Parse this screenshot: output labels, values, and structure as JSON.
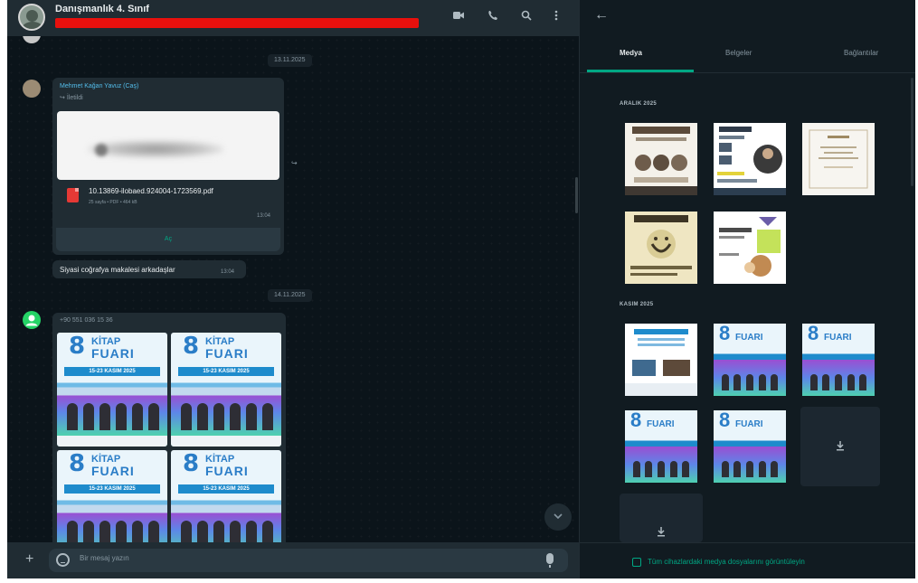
{
  "chat": {
    "title": "Danışmanlık 4. Sınıf",
    "header_icons": [
      "video-call-icon",
      "phone-icon",
      "search-icon",
      "menu-dots-icon"
    ],
    "date_1": "13.11.2025",
    "message_1": {
      "sender": "Mehmet Kağan Yavuz (Caş)",
      "forwarded_label": "İletildi",
      "file_name": "10.13869-ilobaed.924004-1723569.pdf",
      "file_meta": "25 sayfa • PDF • 464 kB",
      "time": "13:04",
      "open_label": "Aç"
    },
    "message_2": {
      "text": "Siyasi coğrafya makalesi arkadaşlar",
      "time": "13:04"
    },
    "date_2": "14.11.2025",
    "message_3": {
      "sender_phone": "+90 551 036 15 36"
    },
    "posters": [
      {
        "num": "8",
        "line1": "KİTAP",
        "line2": "FUARI",
        "date": "15-23 KASIM 2025"
      },
      {
        "num": "8",
        "line1": "KİTAP",
        "line2": "FUARI",
        "date": "15-23 KASIM 2025"
      },
      {
        "num": "8",
        "line1": "KİTAP",
        "line2": "FUARI",
        "date": "15-23 KASIM 2025"
      },
      {
        "num": "8",
        "line1": "KİTAP",
        "line2": "FUARI",
        "date": "15-23 KASIM 2025"
      }
    ],
    "composer": {
      "placeholder": "Bir mesaj yazın"
    }
  },
  "media_panel": {
    "tabs": [
      "Medya",
      "Belgeler",
      "Bağlantılar"
    ],
    "active_tab": "Medya",
    "sections": [
      {
        "title": "ARALIK 2025",
        "count": 5
      },
      {
        "title": "KASIM 2025",
        "count": 7
      }
    ],
    "footer_text": "Tüm cihazlardaki medya dosyalarını görüntüleyin"
  },
  "colors": {
    "accent": "#00a884",
    "panel_bg": "#111b21",
    "bubble_bg": "#202c33",
    "redaction": "#e8100d"
  }
}
